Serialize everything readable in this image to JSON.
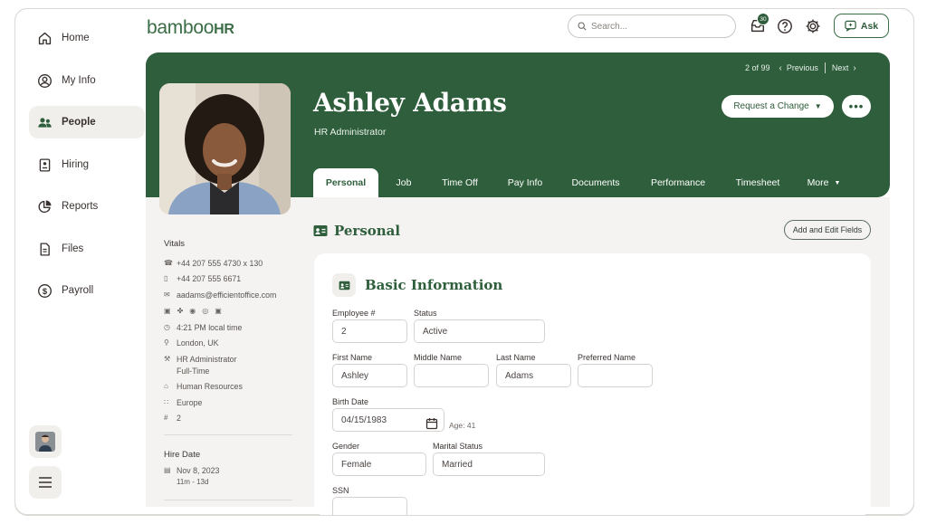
{
  "sidebar": {
    "items": [
      {
        "label": "Home",
        "icon": "home-icon"
      },
      {
        "label": "My Info",
        "icon": "user-circle-icon"
      },
      {
        "label": "People",
        "icon": "people-icon",
        "active": true
      },
      {
        "label": "Hiring",
        "icon": "id-badge-icon"
      },
      {
        "label": "Reports",
        "icon": "pie-chart-icon"
      },
      {
        "label": "Files",
        "icon": "document-icon"
      },
      {
        "label": "Payroll",
        "icon": "dollar-circle-icon"
      }
    ]
  },
  "header": {
    "logo_text": "bamboo",
    "logo_suffix": "HR",
    "search_placeholder": "Search...",
    "inbox_badge": "30",
    "ask_label": "Ask"
  },
  "profile": {
    "pager_position": "2 of 99",
    "pager_previous": "Previous",
    "pager_next": "Next",
    "name": "Ashley Adams",
    "job_title": "HR Administrator",
    "request_change_label": "Request a Change",
    "more_actions_label": "•••",
    "tabs": [
      "Personal",
      "Job",
      "Time Off",
      "Pay Info",
      "Documents",
      "Performance",
      "Timesheet",
      "More"
    ]
  },
  "vitals": {
    "heading": "Vitals",
    "work_phone": "+44 207 555 4730 x 130",
    "mobile_phone": "+44 207 555 6671",
    "email": "aadams@efficientoffice.com",
    "local_time": "4:21 PM local time",
    "location": "London, UK",
    "job_title": "HR Administrator",
    "employment_type": "Full-Time",
    "department": "Human Resources",
    "division": "Europe",
    "employee_number": "2",
    "hire_heading": "Hire Date",
    "hire_date": "Nov 8, 2023",
    "tenure": "11m - 13d"
  },
  "personal": {
    "section_title": "Personal",
    "add_edit_label": "Add and Edit Fields",
    "card_title": "Basic Information",
    "fields": {
      "employee_no_label": "Employee #",
      "employee_no_value": "2",
      "status_label": "Status",
      "status_value": "Active",
      "first_name_label": "First Name",
      "first_name_value": "Ashley",
      "middle_name_label": "Middle Name",
      "middle_name_value": "",
      "last_name_label": "Last Name",
      "last_name_value": "Adams",
      "preferred_name_label": "Preferred Name",
      "preferred_name_value": "",
      "birth_date_label": "Birth Date",
      "birth_date_value": "04/15/1983",
      "age_text": "Age: 41",
      "gender_label": "Gender",
      "gender_value": "Female",
      "marital_status_label": "Marital Status",
      "marital_status_value": "Married",
      "ssn_label": "SSN"
    }
  },
  "colors": {
    "brand_green": "#2e5e3b",
    "page_bg": "#f4f3f1"
  }
}
